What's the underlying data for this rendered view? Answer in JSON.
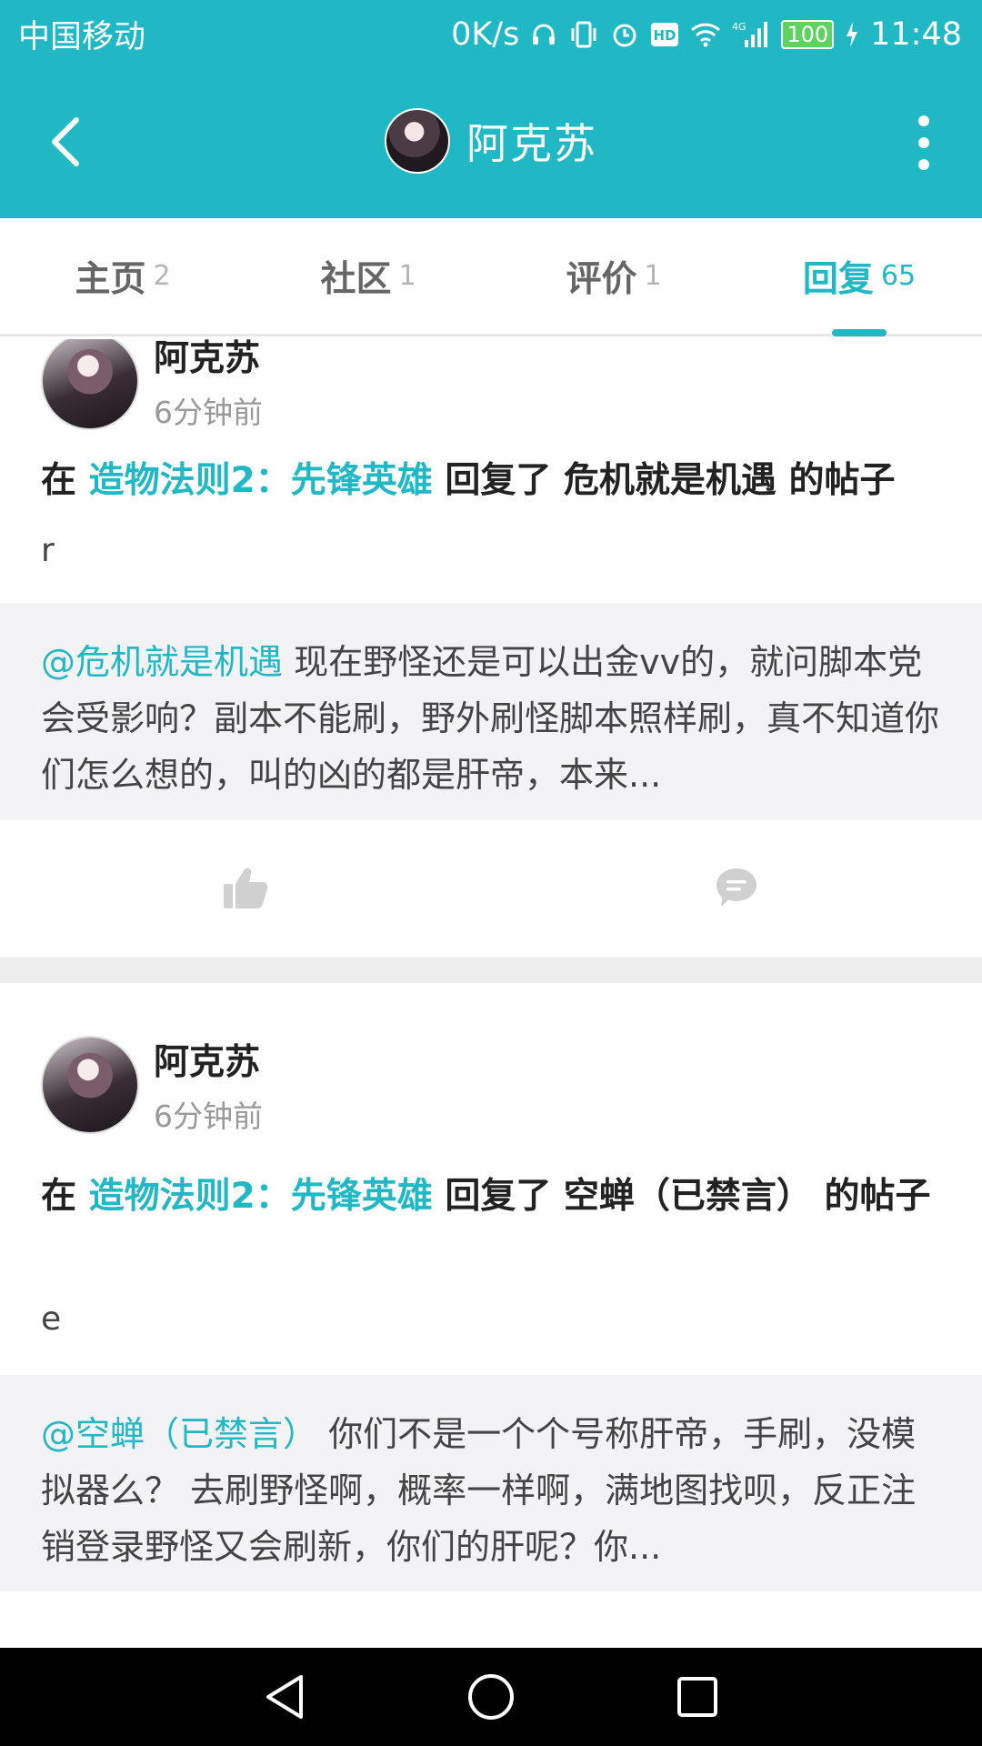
{
  "status_bar": {
    "carrier": "中国移动",
    "net_speed": "0K/s",
    "network": "4G",
    "battery": "100",
    "time": "11:48"
  },
  "header": {
    "title": "阿克苏",
    "back_icon": "back-arrow-icon",
    "more_icon": "more-vertical-icon"
  },
  "tabs": [
    {
      "label": "主页",
      "count": "2"
    },
    {
      "label": "社区",
      "count": "1"
    },
    {
      "label": "评价",
      "count": "1"
    },
    {
      "label": "回复",
      "count": "65",
      "active": true
    }
  ],
  "posts": [
    {
      "author": "阿克苏",
      "time": "6分钟前",
      "prefix": "在",
      "game": "造物法则2：先锋英雄",
      "action": "回复了",
      "target": "危机就是机遇",
      "suffix": "的帖子",
      "body": "r",
      "quote_mention": "@危机就是机遇",
      "quote_text": "现在野怪还是可以出金vv的，就问脚本党会受影响？副本不能刷，野外刷怪脚本照样刷，真不知道你们怎么想的，叫的凶的都是肝帝，本来..."
    },
    {
      "author": "阿克苏",
      "time": "6分钟前",
      "prefix": "在",
      "game": "造物法则2：先锋英雄",
      "action": "回复了",
      "target": "空蝉（已禁言）",
      "suffix": "的帖子",
      "body": "e",
      "quote_mention": "@空蝉（已禁言）",
      "quote_text": "你们不是一个个号称肝帝，手刷，没模拟器么？ 去刷野怪啊，概率一样啊，满地图找呗，反正注销登录野怪又会刷新，你们的肝呢？你..."
    }
  ],
  "colors": {
    "accent": "#21b8c6",
    "quote_bg": "#f3f3f5",
    "divider": "#ededed"
  }
}
